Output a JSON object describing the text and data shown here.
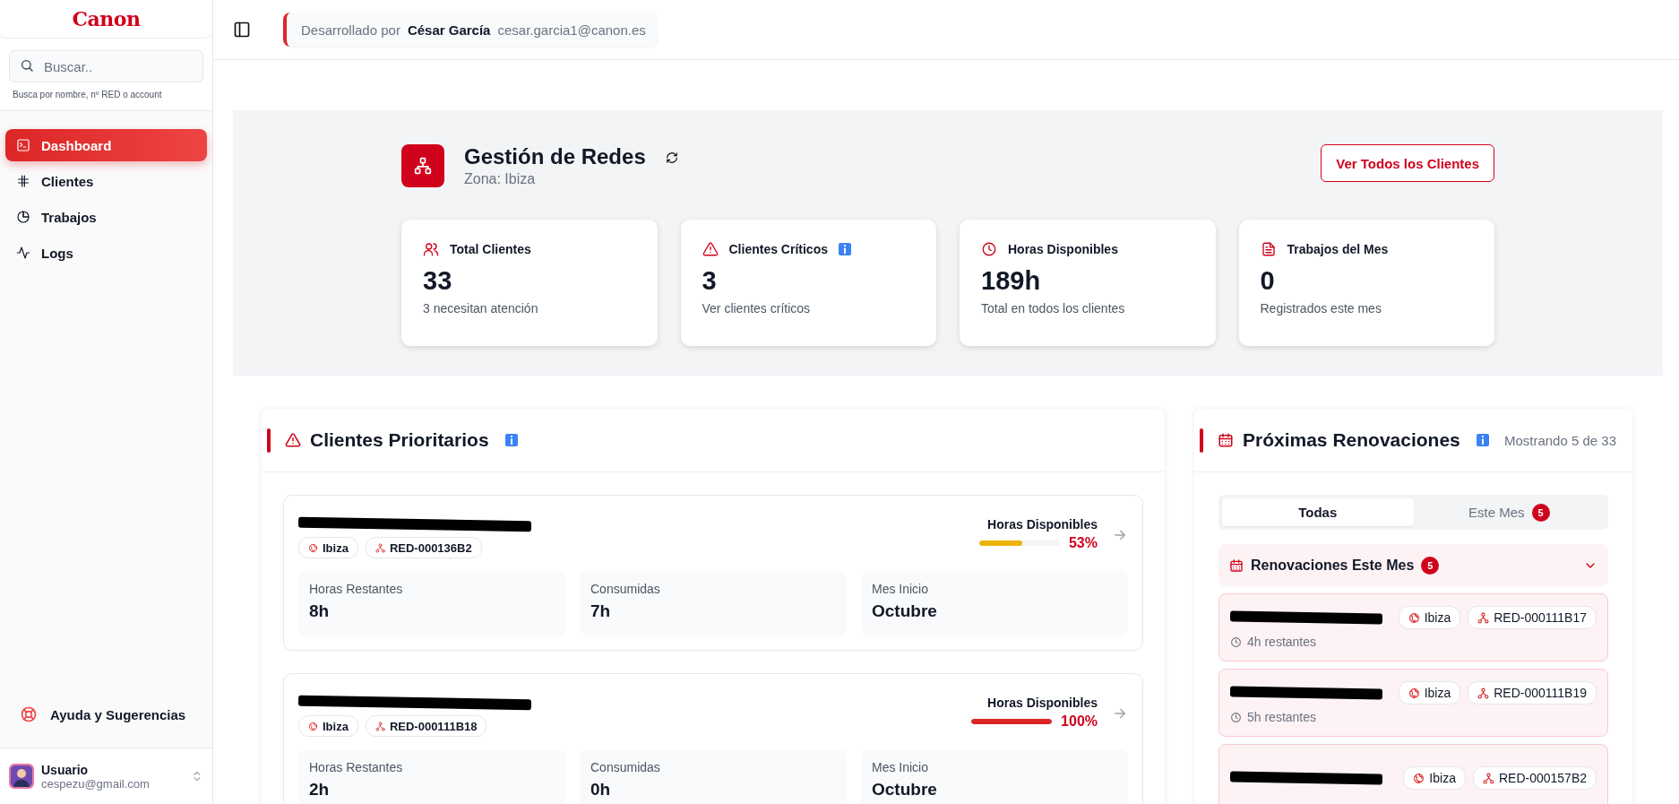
{
  "sidebar": {
    "logo": "Canon",
    "search": {
      "placeholder": "Buscar..",
      "hint": "Busca por nombre, nº RED o account"
    },
    "nav": [
      {
        "label": "Dashboard",
        "selected": true
      },
      {
        "label": "Clientes",
        "selected": false
      },
      {
        "label": "Trabajos",
        "selected": false
      },
      {
        "label": "Logs",
        "selected": false
      }
    ],
    "help": "Ayuda y Sugerencias",
    "user": {
      "name": "Usuario",
      "email": "cespezu@gmail.com"
    }
  },
  "header": {
    "prefix": "Desarrollado por",
    "author": "César García",
    "email": "cesar.garcia1@canon.es"
  },
  "hero": {
    "title": "Gestión de Redes",
    "subtitle": "Zona: Ibiza",
    "button": "Ver Todos los Clientes"
  },
  "stats": [
    {
      "label": "Total Clientes",
      "value": "33",
      "note": "3 necesitan atención",
      "info": false
    },
    {
      "label": "Clientes Críticos",
      "value": "3",
      "note": "Ver clientes críticos",
      "info": true
    },
    {
      "label": "Horas Disponibles",
      "value": "189h",
      "note": "Total en todos los clientes",
      "info": false
    },
    {
      "label": "Trabajos del Mes",
      "value": "0",
      "note": "Registrados este mes",
      "info": false
    }
  ],
  "priority": {
    "title": "Clientes Prioritarios",
    "clients": [
      {
        "zone": "Ibiza",
        "red": "RED-000136B2",
        "meter_label": "Horas Disponibles",
        "level": 0.53,
        "color": "#eab308",
        "percent": "53%",
        "fields": [
          {
            "label": "Horas Restantes",
            "value": "8h"
          },
          {
            "label": "Consumidas",
            "value": "7h"
          },
          {
            "label": "Mes Inicio",
            "value": "Octubre"
          }
        ]
      },
      {
        "zone": "Ibiza",
        "red": "RED-000111B18",
        "meter_label": "Horas Disponibles",
        "level": 1,
        "color": "#dc2626",
        "percent": "100%",
        "fields": [
          {
            "label": "Horas Restantes",
            "value": "2h"
          },
          {
            "label": "Consumidas",
            "value": "0h"
          },
          {
            "label": "Mes Inicio",
            "value": "Octubre"
          }
        ]
      }
    ]
  },
  "renewals": {
    "title": "Próximas Renovaciones",
    "count_note": "Mostrando 5 de 33",
    "tabs": [
      {
        "label": "Todas",
        "selected": true
      },
      {
        "label": "Este Mes",
        "badge": "5",
        "selected": false
      }
    ],
    "group": {
      "title": "Renovaciones Este Mes",
      "badge": "5",
      "expanded": true
    },
    "items": [
      {
        "zone": "Ibiza",
        "red": "RED-000111B17",
        "remaining": "4h restantes"
      },
      {
        "zone": "Ibiza",
        "red": "RED-000111B19",
        "remaining": "5h restantes"
      },
      {
        "zone": "Ibiza",
        "red": "RED-000157B2"
      }
    ]
  }
}
